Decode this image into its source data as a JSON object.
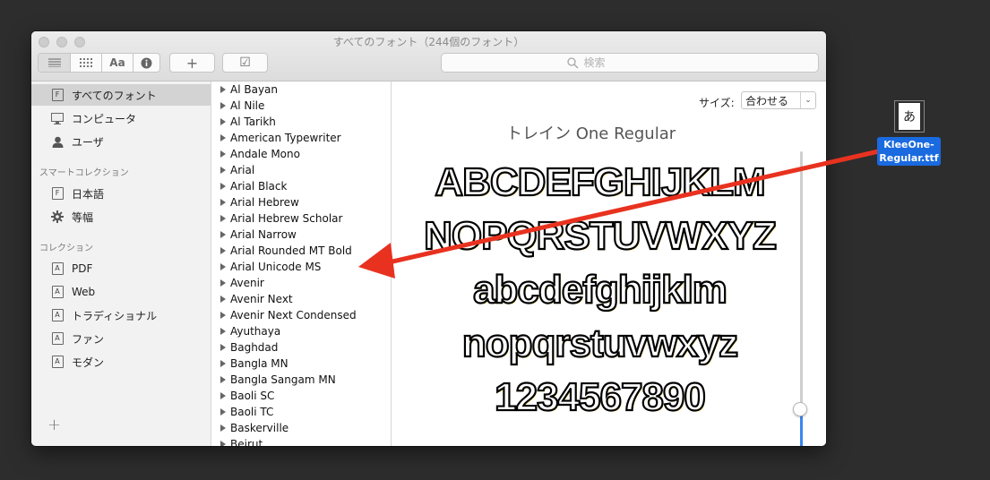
{
  "window": {
    "title": "すべてのフォント（244個のフォント）"
  },
  "toolbar": {
    "view_text_label": "Aa",
    "add_label": "+",
    "validate_label": "☑",
    "search_placeholder": "検索"
  },
  "sidebar": {
    "library_items": [
      {
        "label": "すべてのフォント",
        "icon": "font-book-icon",
        "selected": true
      },
      {
        "label": "コンピュータ",
        "icon": "computer-icon",
        "selected": false
      },
      {
        "label": "ユーザ",
        "icon": "user-icon",
        "selected": false
      }
    ],
    "smart_header": "スマートコレクション",
    "smart_items": [
      {
        "label": "日本語",
        "icon": "font-book-icon"
      },
      {
        "label": "等幅",
        "icon": "gear-icon"
      }
    ],
    "collection_header": "コレクション",
    "collection_items": [
      {
        "label": "PDF",
        "icon": "font-collection-icon"
      },
      {
        "label": "Web",
        "icon": "font-collection-icon"
      },
      {
        "label": "トラディショナル",
        "icon": "font-collection-icon"
      },
      {
        "label": "ファン",
        "icon": "font-collection-icon"
      },
      {
        "label": "モダン",
        "icon": "font-collection-icon"
      }
    ],
    "add_label": "+"
  },
  "font_list": [
    "Al Bayan",
    "Al Nile",
    "Al Tarikh",
    "American Typewriter",
    "Andale Mono",
    "Arial",
    "Arial Black",
    "Arial Hebrew",
    "Arial Hebrew Scholar",
    "Arial Narrow",
    "Arial Rounded MT Bold",
    "Arial Unicode MS",
    "Avenir",
    "Avenir Next",
    "Avenir Next Condensed",
    "Ayuthaya",
    "Baghdad",
    "Bangla MN",
    "Bangla Sangam MN",
    "Baoli SC",
    "Baoli TC",
    "Baskerville",
    "Beirut"
  ],
  "preview": {
    "size_label": "サイズ:",
    "size_value": "合わせる",
    "font_name": "トレイン One Regular",
    "sample_lines": [
      "ABCDEFGHIJKLM",
      "NOPQRSTUVWXYZ",
      "abcdefghijklm",
      "nopqrstuvwxyz",
      "1234567890"
    ]
  },
  "desktop": {
    "file_glyph": "あ",
    "file_name_line1": "KleeOne-",
    "file_name_line2": "Regular.ttf"
  },
  "colors": {
    "selection": "#d3d3d3",
    "accent": "#3a86f0",
    "arrow": "#e8321f",
    "file_label_bg": "#1a6ae0"
  }
}
